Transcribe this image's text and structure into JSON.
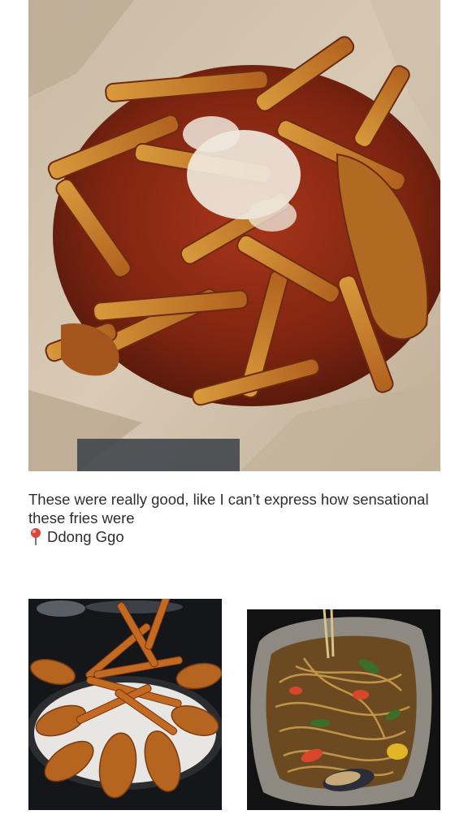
{
  "post": {
    "caption": "These were really good, like I can’t express how sensational these fries were",
    "location": {
      "icon": "map-pin-icon",
      "name": "Ddong Ggo"
    },
    "accent_color": "#e0453a"
  }
}
